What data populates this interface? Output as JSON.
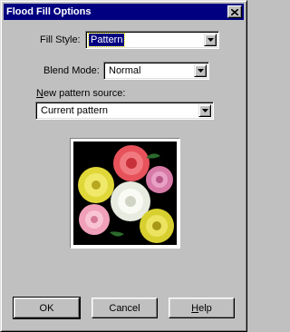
{
  "window": {
    "title": "Flood Fill Options",
    "close_glyph": "×"
  },
  "fill_style": {
    "label": "Fill Style:",
    "value": "Pattern"
  },
  "blend_mode": {
    "label": "Blend Mode:",
    "value": "Normal"
  },
  "pattern_source": {
    "label_mnemonic": "N",
    "label_rest": "ew pattern source:",
    "value": "Current pattern"
  },
  "preview": {
    "icon": "rose-pattern-image"
  },
  "buttons": {
    "ok": "OK",
    "cancel": "Cancel",
    "help_mnemonic": "H",
    "help_rest": "elp"
  },
  "colors": {
    "titlebar": "#000080",
    "face": "#c0c0c0"
  }
}
